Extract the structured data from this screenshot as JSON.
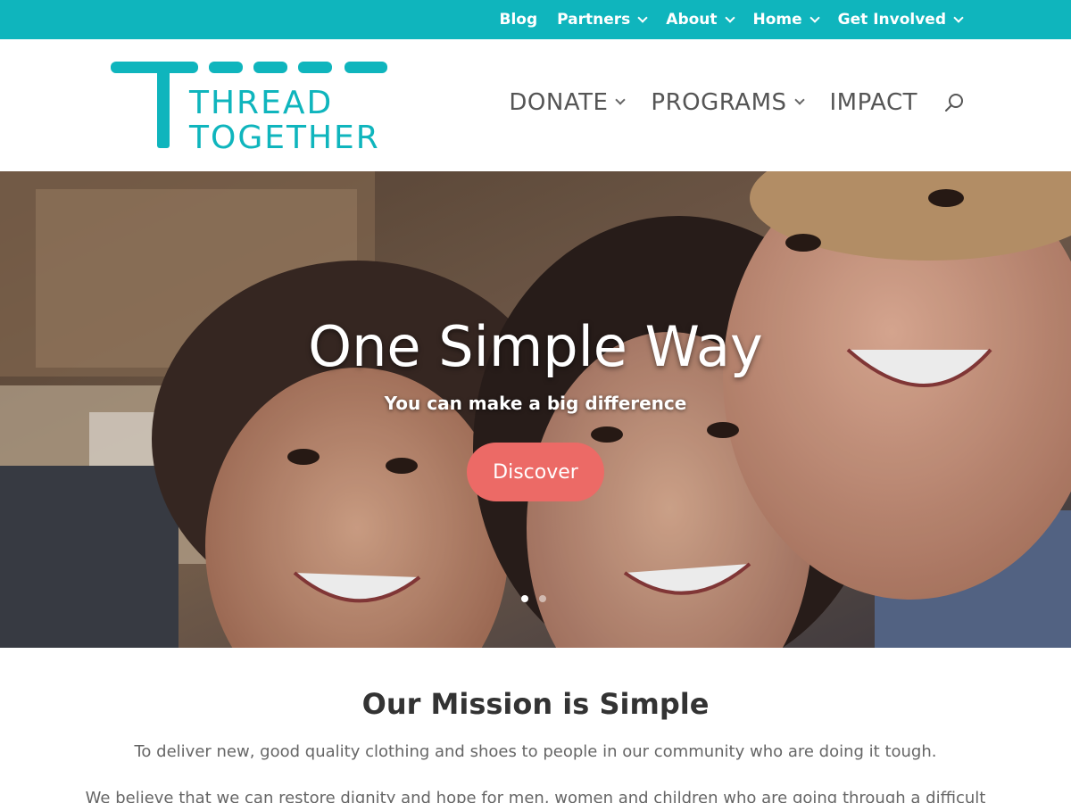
{
  "topnav": {
    "items": [
      {
        "label": "Blog",
        "dropdown": false
      },
      {
        "label": "Partners",
        "dropdown": true
      },
      {
        "label": "About",
        "dropdown": true
      },
      {
        "label": "Home",
        "dropdown": true
      },
      {
        "label": "Get Involved",
        "dropdown": true
      }
    ]
  },
  "logo": {
    "line1": "THREAD",
    "line2": "TOGETHER"
  },
  "mainnav": {
    "items": [
      {
        "label": "DONATE",
        "dropdown": true
      },
      {
        "label": "PROGRAMS",
        "dropdown": true
      },
      {
        "label": "IMPACT",
        "dropdown": false
      }
    ],
    "search_icon": "search-icon"
  },
  "hero": {
    "title": "One Simple Way",
    "subtitle": "You can make a big difference",
    "button_label": "Discover",
    "slides_total": 2,
    "active_slide": 1
  },
  "mission": {
    "title": "Our Mission is Simple",
    "text1": "To deliver new, good quality clothing and shoes to people in our community who are doing it tough.",
    "text2": "We believe that we can restore dignity and hope for men, women and children who are going through a difficult"
  },
  "colors": {
    "brand_teal": "#0fb5bd",
    "button_coral": "#ec6a66"
  }
}
